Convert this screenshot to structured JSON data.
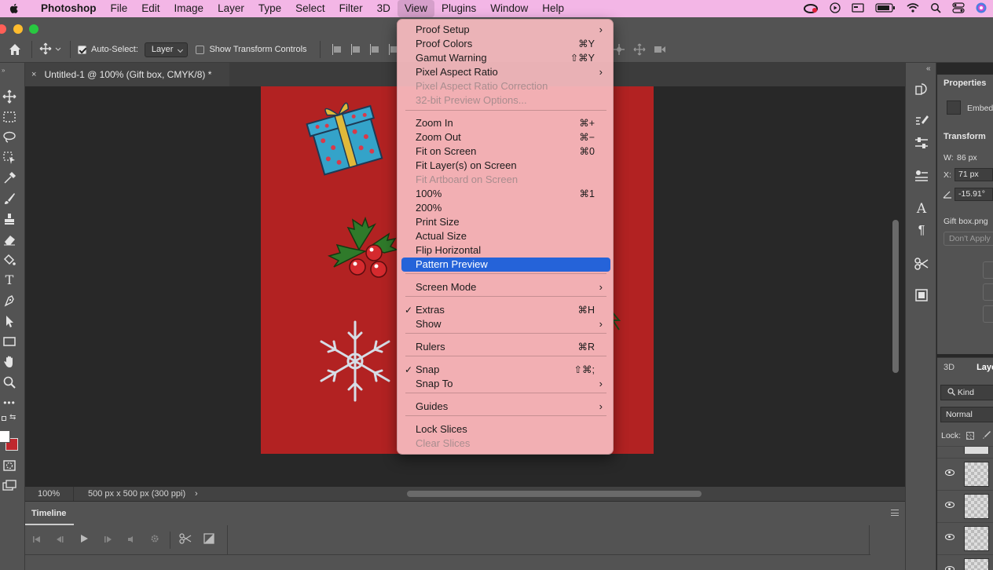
{
  "menubar": {
    "app": "Photoshop",
    "items": [
      "File",
      "Edit",
      "Image",
      "Layer",
      "Type",
      "Select",
      "Filter",
      "3D",
      "View",
      "Plugins",
      "Window",
      "Help"
    ],
    "active": "View"
  },
  "options": {
    "auto_select_label": "Auto-Select:",
    "auto_select_value": "Layer",
    "show_transform_label": "Show Transform Controls"
  },
  "document_tab": {
    "close": "×",
    "title": "Untitled-1 @ 100% (Gift box, CMYK/8) *"
  },
  "status": {
    "zoom": "100%",
    "doc_info": "500 px x 500 px (300 ppi)",
    "arrow": "›"
  },
  "timeline": {
    "title": "Timeline"
  },
  "properties": {
    "title": "Properties",
    "embed": "Embed",
    "transform": "Transform",
    "w_label": "W:",
    "w_value": "86 px",
    "x_label": "X:",
    "x_value": "71 px",
    "angle_value": "-15.91°",
    "file_name": "Gift box.png",
    "dont_apply": "Don't Apply"
  },
  "layers": {
    "tab_3d": "3D",
    "tab_layers": "Layer",
    "kind": "Kind",
    "blend_mode": "Normal",
    "lock": "Lock:"
  },
  "view_menu": {
    "items": [
      {
        "label": "Proof Setup",
        "shortcut": "",
        "submenu": true
      },
      {
        "label": "Proof Colors",
        "shortcut": "⌘Y"
      },
      {
        "label": "Gamut Warning",
        "shortcut": "⇧⌘Y"
      },
      {
        "label": "Pixel Aspect Ratio",
        "shortcut": "",
        "submenu": true
      },
      {
        "label": "Pixel Aspect Ratio Correction",
        "shortcut": "",
        "disabled": true
      },
      {
        "label": "32-bit Preview Options...",
        "shortcut": "",
        "disabled": true
      },
      {
        "label": "Zoom In",
        "shortcut": "⌘+"
      },
      {
        "label": "Zoom Out",
        "shortcut": "⌘−"
      },
      {
        "label": "Fit on Screen",
        "shortcut": "⌘0"
      },
      {
        "label": "Fit Layer(s) on Screen",
        "shortcut": ""
      },
      {
        "label": "Fit Artboard on Screen",
        "shortcut": "",
        "disabled": true
      },
      {
        "label": "100%",
        "shortcut": "⌘1"
      },
      {
        "label": "200%",
        "shortcut": ""
      },
      {
        "label": "Print Size",
        "shortcut": ""
      },
      {
        "label": "Actual Size",
        "shortcut": ""
      },
      {
        "label": "Flip Horizontal",
        "shortcut": ""
      },
      {
        "label": "Pattern Preview",
        "shortcut": "",
        "highlighted": true
      },
      {
        "label": "Screen Mode",
        "shortcut": "",
        "submenu": true
      },
      {
        "label": "Extras",
        "shortcut": "⌘H",
        "checked": true
      },
      {
        "label": "Show",
        "shortcut": "",
        "submenu": true
      },
      {
        "label": "Rulers",
        "shortcut": "⌘R"
      },
      {
        "label": "Snap",
        "shortcut": "⇧⌘;",
        "checked": true
      },
      {
        "label": "Snap To",
        "shortcut": "",
        "submenu": true
      },
      {
        "label": "Guides",
        "shortcut": "",
        "submenu": true
      },
      {
        "label": "Lock Slices",
        "shortcut": ""
      },
      {
        "label": "Clear Slices",
        "shortcut": "",
        "disabled": true
      }
    ],
    "check_glyph": "✓",
    "arrow_glyph": "›"
  },
  "colors": {
    "menubar": "#f3b6e6",
    "artboard": "#b22222",
    "menu_highlight": "#2563d9",
    "foreground_swatch": "#ffffff",
    "background_swatch": "#c0282e"
  },
  "icons": {
    "apple": "apple-icon",
    "home": "home-icon",
    "move": "move-tool-icon",
    "marquee": "marquee-tool-icon",
    "lasso": "lasso-tool-icon",
    "brush": "brush-tool-icon",
    "type": "type-tool-icon",
    "hand": "hand-tool-icon",
    "zoom": "zoom-tool-icon",
    "eye": "eye-icon"
  }
}
